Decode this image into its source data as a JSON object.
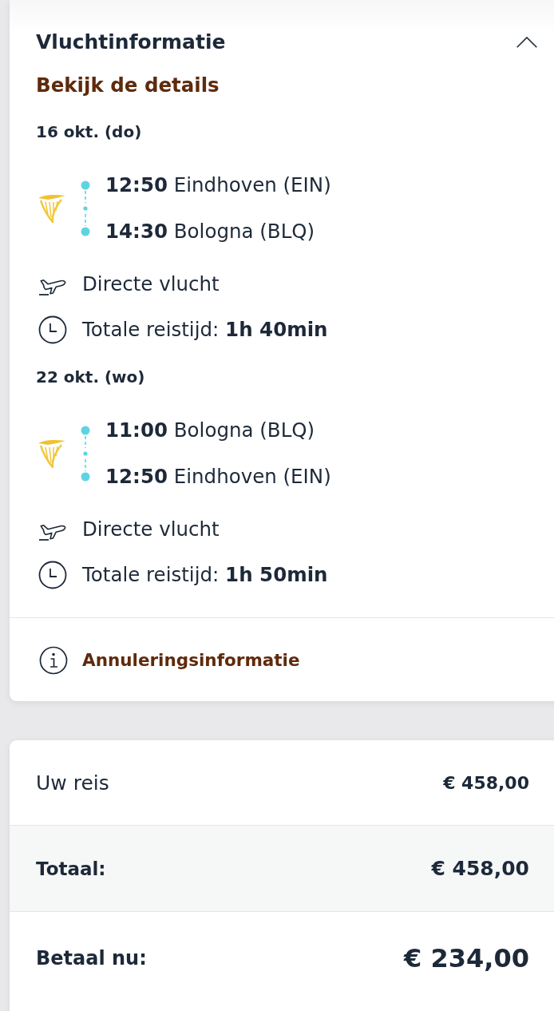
{
  "flight_info": {
    "title": "Vluchtinformatie",
    "expanded": true,
    "details_link": "Bekijk de details",
    "flights": [
      {
        "date": "16 okt. (do)",
        "stops": [
          "**12:50** Eindhoven (EIN)",
          "**14:30** Bologna (BLQ)"
        ],
        "flight_type": "Directe vlucht",
        "duration": "Totale reistijd: **1h 40min**"
      },
      {
        "date": "22 okt. (wo)",
        "stops": [
          "**11:00** Bologna (BLQ)",
          "**12:50** Eindhoven (EIN)"
        ],
        "flight_type": "Directe vlucht",
        "duration": "Totale reistijd: **1h 50min**"
      }
    ],
    "cancellation_link": "Annuleringsinformatie"
  },
  "price_summary": {
    "rows": [
      {
        "kind": "subtotal",
        "label": "Uw reis",
        "amount": "€ 458,00"
      },
      {
        "kind": "total",
        "label": "Totaal:",
        "amount": "€ 458,00"
      },
      {
        "kind": "pay_now",
        "label": "Betaal nu:",
        "amount": "€ 234,00"
      }
    ]
  }
}
